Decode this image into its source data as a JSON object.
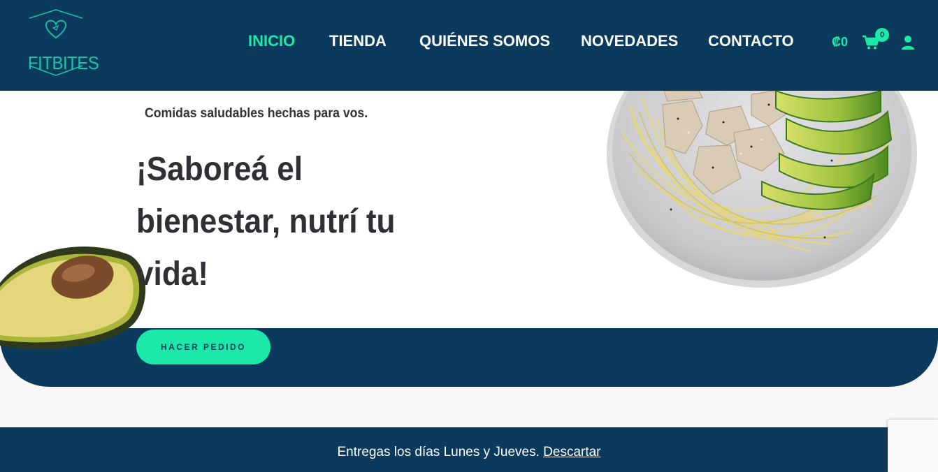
{
  "brand": {
    "name": "FITBITES"
  },
  "nav": {
    "items": [
      {
        "label": "INICIO",
        "active": true
      },
      {
        "label": "TIENDA",
        "active": false
      },
      {
        "label": "QUIÉNES SOMOS",
        "active": false
      },
      {
        "label": "NOVEDADES",
        "active": false
      },
      {
        "label": "CONTACTO",
        "active": false
      }
    ]
  },
  "cart": {
    "total": "₡0",
    "count": "0"
  },
  "hero": {
    "tagline": "Comidas saludables hechas para vos.",
    "headline": "¡Saboreá el bienestar, nutrí tu vida!",
    "cta": "HACER PEDIDO"
  },
  "notice": {
    "text": "Entregas los días Lunes y Jueves.",
    "dismiss": "Descartar"
  },
  "colors": {
    "primary": "#0b3a5c",
    "accent": "#1ce8a8",
    "text": "#2f3036"
  }
}
